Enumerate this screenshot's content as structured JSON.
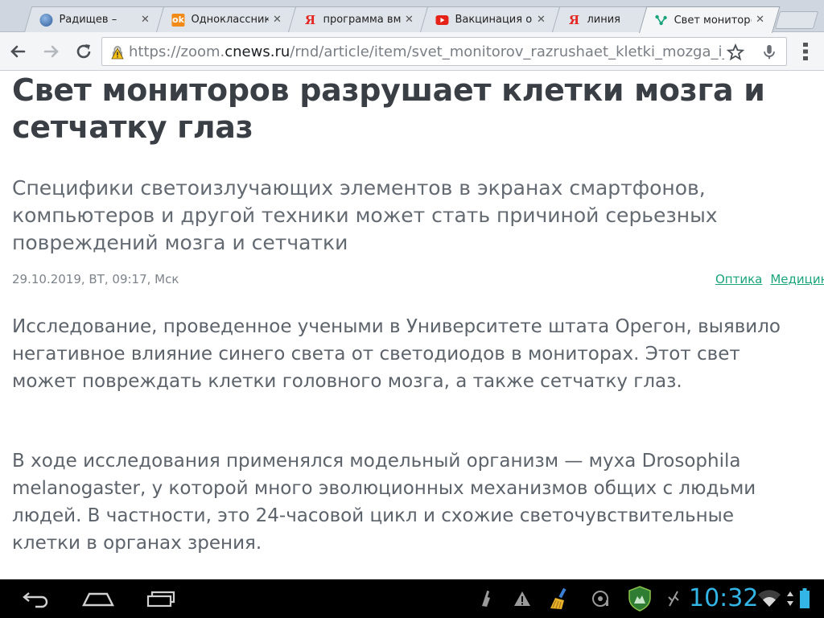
{
  "browser": {
    "tabs": [
      {
        "title": "Радищев –",
        "favicon": "globe-icon",
        "active": false
      },
      {
        "title": "Одноклассник",
        "favicon": "odnoklassniki-icon",
        "active": false
      },
      {
        "title": "программа вм",
        "favicon": "yandex-icon",
        "active": false
      },
      {
        "title": "Вакцинация от",
        "favicon": "youtube-icon",
        "active": false
      },
      {
        "title": "линия",
        "favicon": "yandex-icon",
        "active": false
      },
      {
        "title": "Свет мониторо",
        "favicon": "cnews-icon",
        "active": true
      }
    ],
    "close_glyph": "✕",
    "url": {
      "scheme": "https://zoom.",
      "host": "cnews.ru",
      "path": "/rnd/article/item/svet_monitorov_razrushaet_kletki_mozga_i_s"
    }
  },
  "article": {
    "headline": "Свет мониторов разрушает клетки мозга и сетчатку глаз",
    "lead": "Специфики светоизлучающих элементов в экранах смартфонов, компьютеров и другой техники может стать причиной серьезных повреждений мозга и сетчатки",
    "date": "29.10.2019, ВТ, 09:17, Мск",
    "tags": [
      "Оптика",
      "Медицина"
    ],
    "paragraphs": [
      "Исследование, проведенное учеными в Университете штата Орегон, выявило негативное влияние синего света от светодиодов в мониторах. Этот свет может повреждать клетки головного мозга, а также сетчатку глаз.",
      "В ходе исследования применялся модельный организм — муха Drosophila melanogaster, у которой много эволюционных механизмов общих с людьми людей. В частности, это 24-часовой цикл и схожие светочувствительные клетки в органах зрения."
    ]
  },
  "system": {
    "time": "10:32",
    "clock_color": "#33b5e5",
    "link_color": "#1aa47b"
  }
}
